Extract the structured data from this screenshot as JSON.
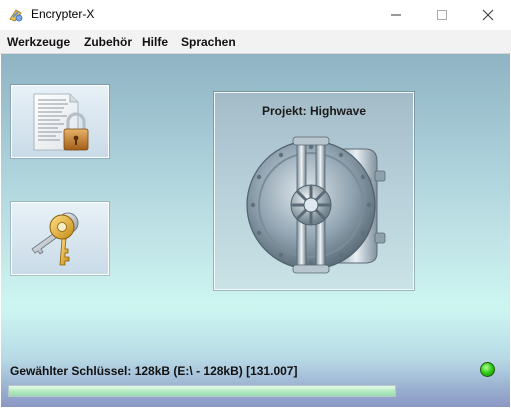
{
  "window": {
    "title": "Encrypter-X",
    "icon": "app-logo-icon"
  },
  "menu": {
    "items": [
      "Werkzeuge",
      "Zubehör",
      "Hilfe",
      "Sprachen"
    ]
  },
  "tools": {
    "encrypt_document_icon": "document-lock-icon",
    "keys_icon": "keys-icon"
  },
  "vault": {
    "label": "Projekt: Highwave",
    "icon": "vault-door-icon"
  },
  "status": {
    "text": "Gewählter Schlüssel: 128kB (E:\\ - 128kB) [131.007]",
    "indicator_color": "#2ecc18",
    "progress": 1.0
  },
  "colors": {
    "accent_green": "#35d21a"
  }
}
